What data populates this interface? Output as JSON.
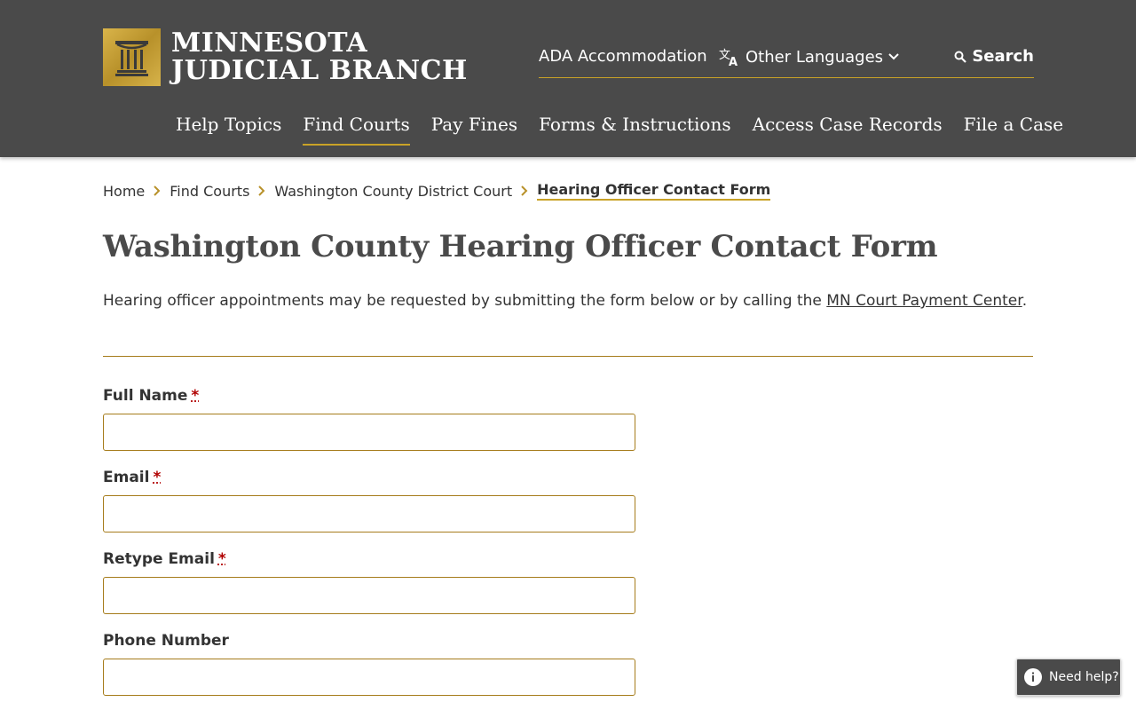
{
  "header": {
    "logo_line1": "MINNESOTA",
    "logo_line2": "JUDICIAL BRANCH",
    "util": {
      "ada": "ADA Accommodation",
      "languages": "Other Languages",
      "search": "Search"
    },
    "nav": [
      {
        "label": "Help Topics"
      },
      {
        "label": "Find Courts"
      },
      {
        "label": "Pay Fines"
      },
      {
        "label": "Forms & Instructions"
      },
      {
        "label": "Access Case Records"
      },
      {
        "label": "File a Case"
      }
    ]
  },
  "breadcrumb": [
    {
      "label": "Home"
    },
    {
      "label": "Find Courts"
    },
    {
      "label": "Washington County District Court"
    },
    {
      "label": "Hearing Officer Contact Form"
    }
  ],
  "page": {
    "title": "Washington County Hearing Officer Contact Form",
    "intro_text": "Hearing officer appointments may be requested by submitting the form below or by calling the ",
    "intro_link": "MN Court Payment Center",
    "intro_end": "."
  },
  "form": {
    "fields": [
      {
        "label": "Full Name",
        "required_mark": "*",
        "value": ""
      },
      {
        "label": "Email",
        "required_mark": "*",
        "value": ""
      },
      {
        "label": "Retype Email",
        "required_mark": "*",
        "value": ""
      },
      {
        "label": "Phone Number",
        "value": ""
      }
    ]
  },
  "help": {
    "label": "Need help?"
  },
  "colors": {
    "header_bg": "#4a4a4a",
    "accent_gold": "#c9a227",
    "required": "#b00000"
  }
}
